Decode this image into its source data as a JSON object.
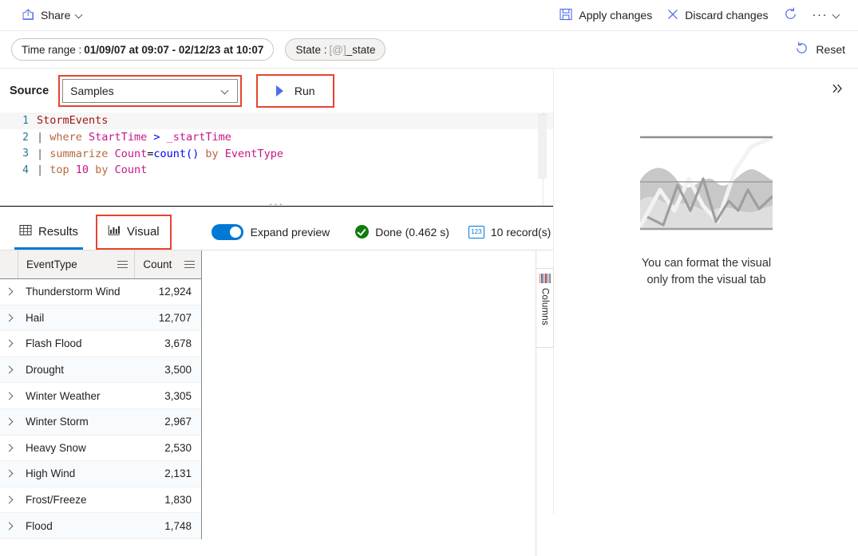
{
  "commandbar": {
    "share": {
      "label": "Share",
      "icon": "share-icon",
      "chevron": "chevron-down-icon"
    },
    "apply": {
      "label": "Apply changes",
      "icon": "save-icon"
    },
    "discard": {
      "label": "Discard changes",
      "icon": "close-icon"
    },
    "refresh": {
      "icon": "refresh-icon"
    },
    "overflow": {
      "label": "···",
      "chevron": "chevron-down-icon"
    }
  },
  "filterbar": {
    "time_range": {
      "label": "Time range :",
      "value": "01/09/07 at 09:07 - 02/12/23 at 10:07"
    },
    "state": {
      "label": "State :",
      "value_dim": "[@]",
      "value": "_state"
    },
    "reset": {
      "label": "Reset",
      "icon": "undo-icon"
    }
  },
  "query": {
    "source_label": "Source",
    "source_value": "Samples",
    "source_chevron": "chevron-down-icon",
    "run_label": "Run",
    "run_icon": "play-icon",
    "lines": [
      {
        "num": "1",
        "tokens": [
          {
            "t": "StormEvents",
            "c": "tok-tbl"
          }
        ]
      },
      {
        "num": "2",
        "tokens": [
          {
            "t": "| ",
            "c": "tok-pipe"
          },
          {
            "t": "where",
            "c": "tok-kw"
          },
          {
            "t": " ",
            "c": "tok-plain"
          },
          {
            "t": "StartTime",
            "c": "tok-col"
          },
          {
            "t": " ",
            "c": "tok-plain"
          },
          {
            "t": ">",
            "c": "tok-op"
          },
          {
            "t": " ",
            "c": "tok-plain"
          },
          {
            "t": "_startTime",
            "c": "tok-col"
          }
        ]
      },
      {
        "num": "3",
        "tokens": [
          {
            "t": "| ",
            "c": "tok-pipe"
          },
          {
            "t": "summarize",
            "c": "tok-kw"
          },
          {
            "t": " ",
            "c": "tok-plain"
          },
          {
            "t": "Count",
            "c": "tok-col"
          },
          {
            "t": "=",
            "c": "tok-plain"
          },
          {
            "t": "count()",
            "c": "tok-fn"
          },
          {
            "t": " ",
            "c": "tok-plain"
          },
          {
            "t": "by",
            "c": "tok-kw"
          },
          {
            "t": " ",
            "c": "tok-plain"
          },
          {
            "t": "EventType",
            "c": "tok-col"
          }
        ]
      },
      {
        "num": "4",
        "tokens": [
          {
            "t": "| ",
            "c": "tok-pipe"
          },
          {
            "t": "top",
            "c": "tok-kw"
          },
          {
            "t": " ",
            "c": "tok-plain"
          },
          {
            "t": "10",
            "c": "tok-num"
          },
          {
            "t": " ",
            "c": "tok-plain"
          },
          {
            "t": "by",
            "c": "tok-kw"
          },
          {
            "t": " ",
            "c": "tok-plain"
          },
          {
            "t": "Count",
            "c": "tok-col"
          }
        ]
      }
    ]
  },
  "results": {
    "tabs": [
      {
        "label": "Results",
        "icon": "table-icon",
        "selected": true,
        "highlighted": false
      },
      {
        "label": "Visual",
        "icon": "bar-chart-icon",
        "selected": false,
        "highlighted": true
      }
    ],
    "expand_preview_label": "Expand preview",
    "expand_preview_on": true,
    "status_label": "Done (0.462 s)",
    "status_icon": "check-circle-icon",
    "records_label": "10 record(s)",
    "records_icon": "number-badge-icon",
    "columns_tab_label": "Columns",
    "columns_tab_icon": "columns-icon"
  },
  "table": {
    "columns": [
      "EventType",
      "Count"
    ],
    "rows": [
      {
        "EventType": "Thunderstorm Wind",
        "Count": "12,924"
      },
      {
        "EventType": "Hail",
        "Count": "12,707"
      },
      {
        "EventType": "Flash Flood",
        "Count": "3,678"
      },
      {
        "EventType": "Drought",
        "Count": "3,500"
      },
      {
        "EventType": "Winter Weather",
        "Count": "3,305"
      },
      {
        "EventType": "Winter Storm",
        "Count": "2,967"
      },
      {
        "EventType": "Heavy Snow",
        "Count": "2,530"
      },
      {
        "EventType": "High Wind",
        "Count": "2,131"
      },
      {
        "EventType": "Frost/Freeze",
        "Count": "1,830"
      },
      {
        "EventType": "Flood",
        "Count": "1,748"
      }
    ]
  },
  "visual_panel": {
    "expand_icon": "chevron-double-right-icon",
    "illustration": "chart-placeholder-illustration",
    "message_line1": "You can format the visual",
    "message_line2": "only from the visual tab"
  },
  "colors": {
    "accent": "#0078d4",
    "highlight_box": "#e8432f",
    "success": "#107c10",
    "link": "#0078d4"
  }
}
